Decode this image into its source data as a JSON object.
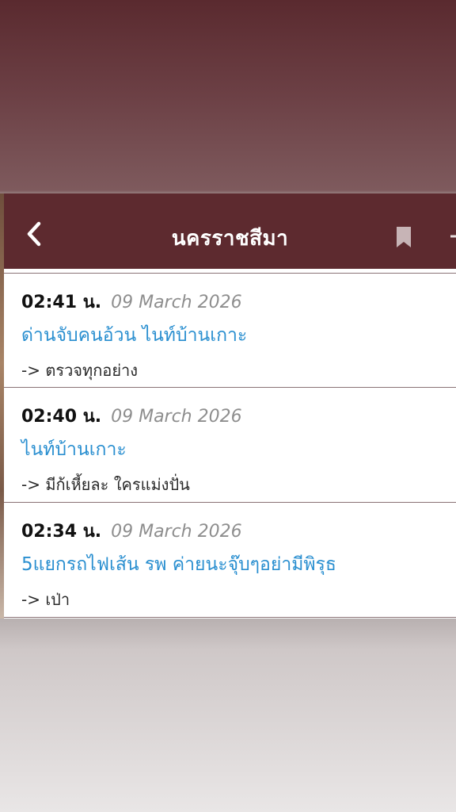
{
  "header": {
    "title": "นครราชสีมา",
    "back_icon": "chevron-left-icon",
    "bookmark_icon": "bookmark-icon",
    "add_icon": "plus-icon",
    "bar_color": "#5d2a2f"
  },
  "posts": [
    {
      "time": "02:41 น.",
      "date": "09 March 2026",
      "headline": "ด่านจับคนอ้วน ไนท์บ้านเกาะ",
      "note": "-> ตรวจทุกอย่าง"
    },
    {
      "time": "02:40 น.",
      "date": "09 March 2026",
      "headline": "ไนท์บ้านเกาะ",
      "note": "-> มีก้เหี้ยละ ใครแม่งปั่น"
    },
    {
      "time": "02:34 น.",
      "date": "09 March 2026",
      "headline": "5แยกรถไฟเส้น รพ ค่ายนะจุ๊บๆอย่ามีพิรุธ",
      "note": "-> เป่า"
    }
  ],
  "colors": {
    "headline": "#2a8fd0",
    "date": "#8e8e8e",
    "divider": "#8a7275"
  }
}
